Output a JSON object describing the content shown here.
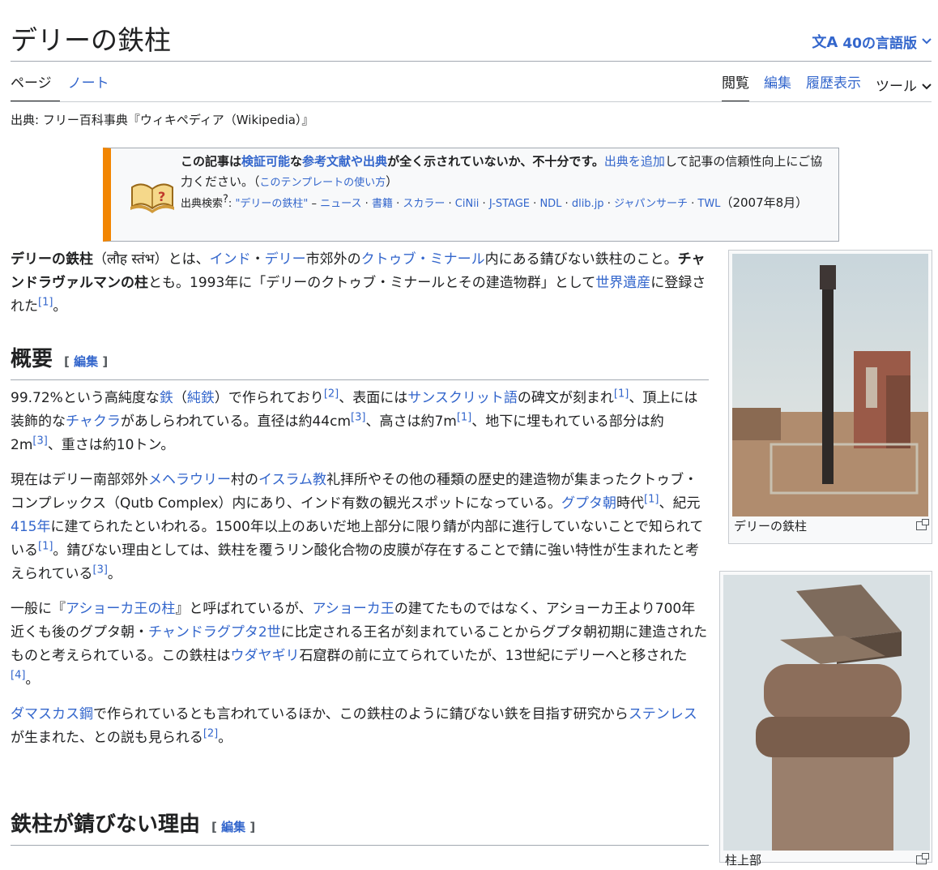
{
  "page": {
    "title": "デリーの鉄柱",
    "language_button": "40の言語版",
    "tabs_left": [
      "ページ",
      "ノート"
    ],
    "tabs_right": [
      "閲覧",
      "編集",
      "履歴表示"
    ],
    "tools_label": "ツール",
    "source": "出典: フリー百科事典『ウィキペディア（Wikipedia）』"
  },
  "ambox": {
    "b1": "この記事は",
    "l1": "検証可能",
    "b2": "な",
    "l2": "参考文献や出典",
    "b3": "が全く示されていないか、不十分です。",
    "l3": "出典を追加",
    "t1": "して記事の信頼性向上にご協力ください。（",
    "l4": "このテンプレートの使い方",
    "t2": "）",
    "search_label": "出典検索",
    "search_sup": "?",
    "search_colon": ": ",
    "query": "\"デリーの鉄柱\"",
    "dash": " – ",
    "sources": [
      "ニュース",
      "書籍",
      "スカラー",
      "CiNii",
      "J-STAGE",
      "NDL",
      "dlib.jp",
      "ジャパンサーチ",
      "TWL"
    ],
    "date": "（2007年8月）"
  },
  "intro": {
    "bold_name": "デリーの鉄柱",
    "hindi": "（लौह स्तंभ）とは、",
    "link_india": "インド",
    "dot": "・",
    "link_delhi": "デリー",
    "t1": "市郊外の",
    "link_qutb": "クトゥブ・ミナール",
    "t2": "内にある錆びない鉄柱のこと。",
    "bold_alias": "チャンドラヴァルマンの柱",
    "t3": "とも。1993年に「デリーのクトゥブ・ミナールとその建造物群」として",
    "link_heritage": "世界遺産",
    "t4": "に登録された",
    "ref1": "[1]",
    "t5": "。"
  },
  "section1": {
    "heading": "概要",
    "edit": "編集"
  },
  "p1": {
    "t1": "99.72%という高純度な",
    "l_iron": "鉄",
    "t2": "（",
    "l_pure": "純鉄",
    "t3": "）で作られており",
    "r2": "[2]",
    "t4": "、表面には",
    "l_sanskrit": "サンスクリット語",
    "t5": "の碑文が刻まれ",
    "r1a": "[1]",
    "t6": "、頂上には装飾的な",
    "l_chakra": "チャクラ",
    "t7": "があしらわれている。直径は約44cm",
    "r3a": "[3]",
    "t8": "、高さは約7m",
    "r1b": "[1]",
    "t9": "、地下に埋もれている部分は約2m",
    "r3b": "[3]",
    "t10": "、重さは約10トン。"
  },
  "p2": {
    "t1": "現在はデリー南部郊外",
    "l_mehrauli": "メヘラウリー",
    "t2": "村の",
    "l_islam": "イスラム教",
    "t3": "礼拝所やその他の種類の歴史的建造物が集まったクトゥブ・コンプレックス（Qutb Complex）内にあり、インド有数の観光スポットになっている。",
    "l_gupta": "グプタ朝",
    "t4": "時代",
    "r1a": "[1]",
    "t5": "、紀元",
    "l_415": "415年",
    "t6": "に建てられたといわれる。1500年以上のあいだ地上部分に限り錆が内部に進行していないことで知られている",
    "r1b": "[1]",
    "t7": "。錆びない理由としては、鉄柱を覆うリン酸化合物の皮膜が存在することで錆に強い特性が生まれたと考えられている",
    "r3": "[3]",
    "t8": "。"
  },
  "p3": {
    "t1": "一般に『",
    "l_ashoka_pillar": "アショーカ王の柱",
    "t2": "』と呼ばれているが、",
    "l_ashoka": "アショーカ王",
    "t3": "の建てたものではなく、アショーカ王より700年近くも後のグプタ朝・",
    "l_chandragupta": "チャンドラグプタ2世",
    "t4": "に比定される王名が刻まれていることからグプタ朝初期に建造されたものと考えられている。この鉄柱は",
    "l_udayagiri": "ウダヤギリ",
    "t5": "石窟群の前に立てられていたが、13世紀にデリーへと移された",
    "r4": "[4]",
    "t6": "。"
  },
  "p4": {
    "l_damascus": "ダマスカス鋼",
    "t1": "で作られているとも言われているほか、この鉄柱のように錆びない鉄を目指す研究から",
    "l_stainless": "ステンレス",
    "t2": "が生まれた、との説も見られる",
    "r2": "[2]",
    "t3": "。"
  },
  "section2": {
    "heading": "鉄柱が錆びない理由",
    "edit": "編集"
  },
  "thumb1": {
    "caption": "デリーの鉄柱"
  },
  "thumb2": {
    "caption": "柱上部"
  }
}
